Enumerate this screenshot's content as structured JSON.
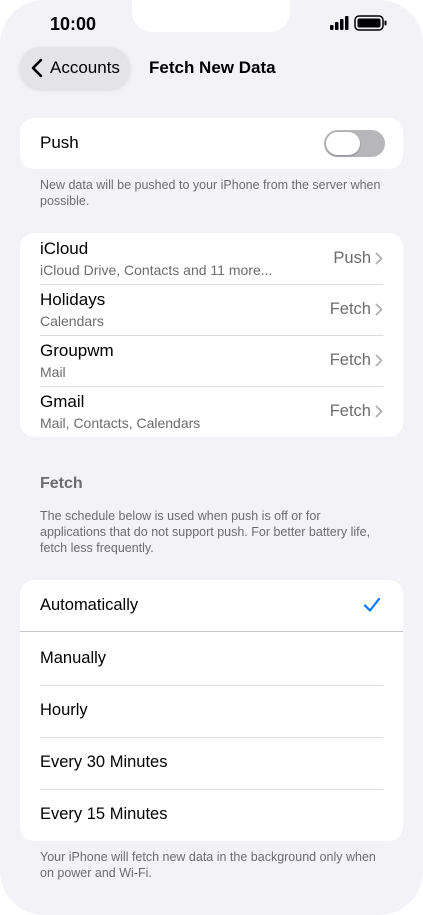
{
  "status_bar": {
    "time": "10:00",
    "signal_icon": "signal-bars-icon",
    "battery_icon": "battery-icon"
  },
  "nav": {
    "back_label": "Accounts",
    "title": "Fetch New Data"
  },
  "push": {
    "label": "Push",
    "enabled": false,
    "footnote": "New data will be pushed to your iPhone from the server when possible."
  },
  "accounts": [
    {
      "name": "iCloud",
      "detail": "iCloud Drive, Contacts and 11 more...",
      "mode": "Push"
    },
    {
      "name": "Holidays",
      "detail": "Calendars",
      "mode": "Fetch"
    },
    {
      "name": "Groupwm",
      "detail": "Mail",
      "mode": "Fetch"
    },
    {
      "name": "Gmail",
      "detail": "Mail, Contacts, Calendars",
      "mode": "Fetch"
    }
  ],
  "fetch": {
    "header": "Fetch",
    "description": "The schedule below is used when push is off or for applications that do not support push. For better battery life, fetch less frequently.",
    "options": [
      {
        "label": "Automatically",
        "selected": true
      },
      {
        "label": "Manually",
        "selected": false
      },
      {
        "label": "Hourly",
        "selected": false
      },
      {
        "label": "Every 30 Minutes",
        "selected": false
      },
      {
        "label": "Every 15 Minutes",
        "selected": false
      }
    ],
    "footnote": "Your iPhone will fetch new data in the background only when on power and Wi-Fi."
  },
  "colors": {
    "accent": "#007aff",
    "background": "#f2f2f7",
    "secondary_text": "#6c6c70",
    "toggle_off": "#b6b6bb"
  }
}
